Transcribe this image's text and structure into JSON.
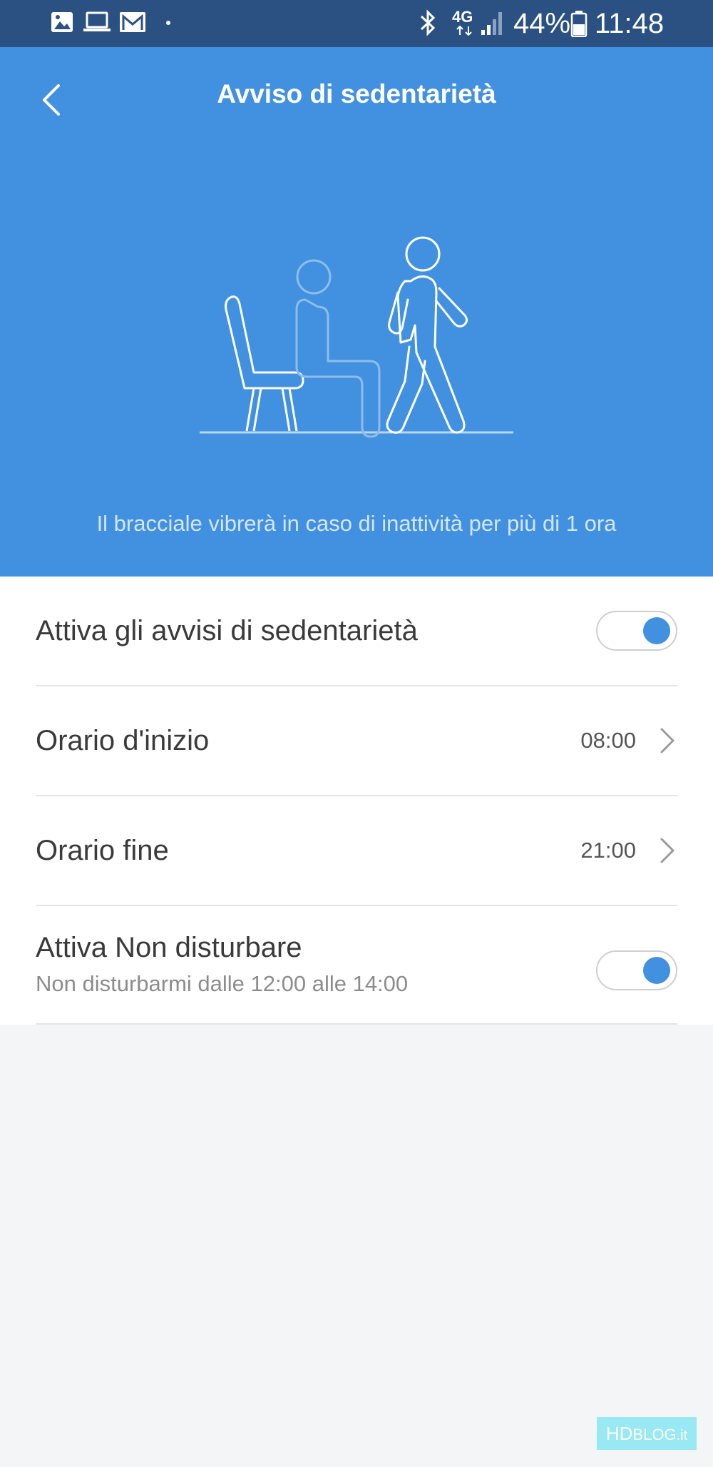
{
  "status_bar": {
    "notification_icons": [
      "image-icon",
      "laptop-icon",
      "gmail-icon",
      "dot-icon"
    ],
    "system_icons": [
      "bluetooth-icon",
      "network-4g-icon",
      "signal-icon"
    ],
    "network": "4G",
    "battery": "44%",
    "time": "11:48"
  },
  "header": {
    "back_icon": "chevron-left-icon",
    "title": "Avviso di sedentarietà",
    "illustration": "sitting-and-walking-figures",
    "description": "Il bracciale vibrerà in caso di inattività per più di 1 ora",
    "background_color": "#4291e1"
  },
  "settings": {
    "items": [
      {
        "label": "Attiva gli avvisi di sedentarietà",
        "control": "toggle",
        "enabled": true
      },
      {
        "label": "Orario d'inizio",
        "value": "08:00",
        "control": "chevron"
      },
      {
        "label": "Orario fine",
        "value": "21:00",
        "control": "chevron"
      },
      {
        "label": "Attiva Non disturbare",
        "sublabel": "Non disturbarmi dalle 12:00 alle 14:00",
        "control": "toggle",
        "enabled": true
      }
    ]
  },
  "watermark": {
    "brand": "HD",
    "name": "BLOG",
    "suffix": ".it"
  },
  "colors": {
    "accent": "#4291e1",
    "status_bar": "#2b5182",
    "background": "#f4f5f7"
  }
}
